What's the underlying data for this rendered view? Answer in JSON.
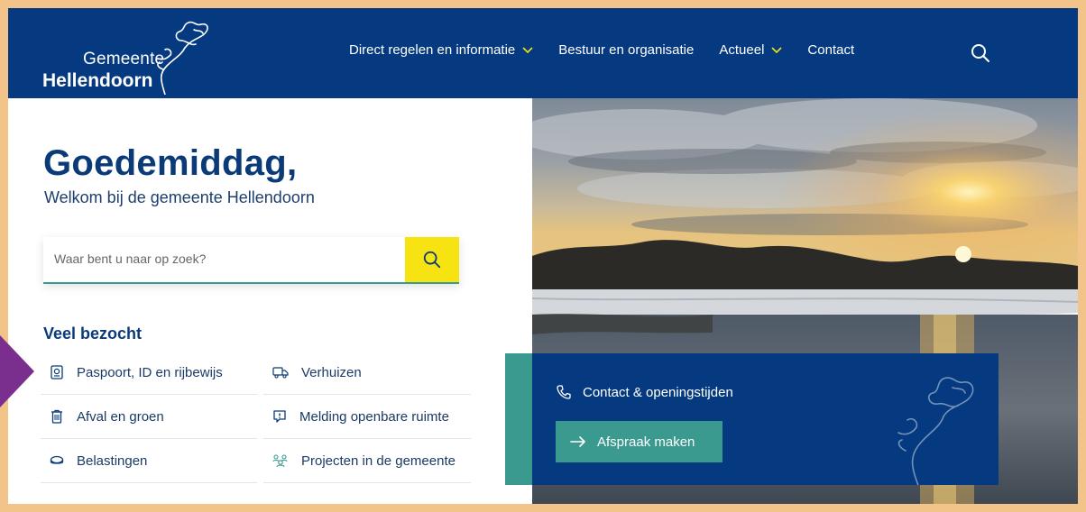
{
  "header": {
    "logo": {
      "line1": "Gemeente",
      "line2": "Hellendoorn"
    },
    "nav": [
      {
        "label": "Direct regelen en informatie",
        "has_dropdown": true
      },
      {
        "label": "Bestuur en organisatie",
        "has_dropdown": false
      },
      {
        "label": "Actueel",
        "has_dropdown": true
      },
      {
        "label": "Contact",
        "has_dropdown": false
      }
    ],
    "search_icon": "search-icon"
  },
  "main": {
    "greeting": "Goedemiddag,",
    "welcome": "Welkom bij de gemeente Hellendoorn",
    "search": {
      "placeholder": "Waar bent u naar op zoek?",
      "value": ""
    }
  },
  "veel_bezocht": {
    "title": "Veel bezocht",
    "items": [
      {
        "label": "Paspoort, ID en rijbewijs",
        "icon": "passport-icon"
      },
      {
        "label": "Verhuizen",
        "icon": "truck-icon"
      },
      {
        "label": "Afval en groen",
        "icon": "trash-icon"
      },
      {
        "label": "Melding openbare ruimte",
        "icon": "report-icon"
      },
      {
        "label": "Belastingen",
        "icon": "coins-icon"
      },
      {
        "label": "Projecten in de gemeente",
        "icon": "people-icon"
      }
    ]
  },
  "contact_panel": {
    "contact_label": "Contact & openingstijden",
    "appointment_label": "Afspraak maken"
  },
  "colors": {
    "brand_blue": "#063a80",
    "teal": "#3a9a8f",
    "yellow": "#f7e312",
    "frame": "#f2c48a"
  }
}
